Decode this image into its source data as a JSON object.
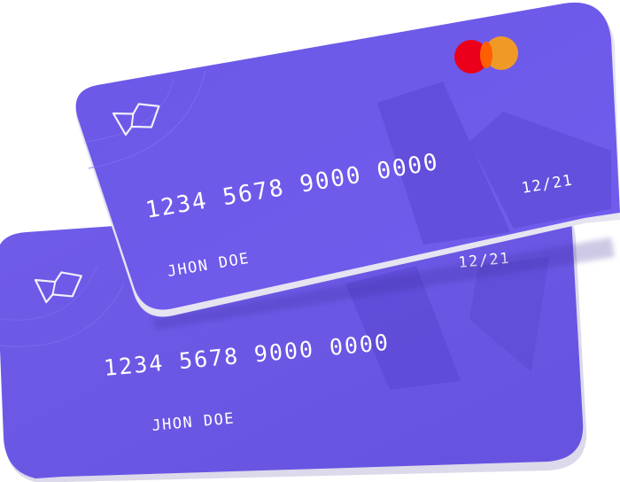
{
  "cards": {
    "back": {
      "number": "1234 5678 9000 0000",
      "holder": "JHON DOE",
      "expiry": "12/21"
    },
    "front": {
      "number": "1234 5678 9000 0000",
      "holder": "JHON DOE",
      "expiry": "12/21"
    }
  },
  "colors": {
    "card_face": "#6b57e6",
    "card_face_dark": "#5a45d6",
    "card_edge": "#e4e2ee",
    "text": "#ffffff",
    "mastercard_red": "#eb001b",
    "mastercard_yellow": "#f79e1b"
  },
  "icons": {
    "brand_logo": "brand-logo-icon",
    "card_network": "mastercard-icon"
  }
}
